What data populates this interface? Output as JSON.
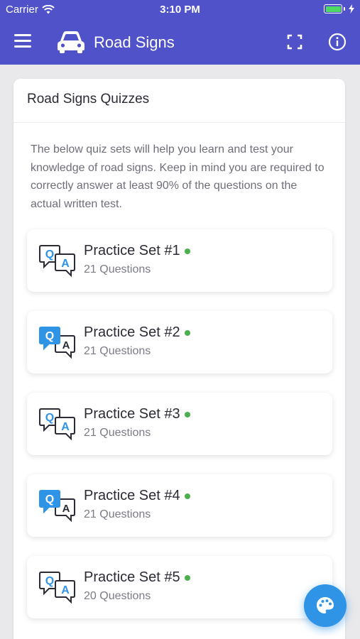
{
  "status": {
    "carrier": "Carrier",
    "time": "3:10 PM"
  },
  "appbar": {
    "title": "Road Signs"
  },
  "section": {
    "title": "Road Signs Quizzes",
    "description": "The below quiz sets will help you learn and test your knowledge of road signs. Keep in mind you are required to correctly answer at least 90% of the questions on the actual written test."
  },
  "quizzes": [
    {
      "name": "Practice Set #1",
      "count": "21 Questions",
      "icon": "qa-outline-icon"
    },
    {
      "name": "Practice Set #2",
      "count": "21 Questions",
      "icon": "qa-filled-icon"
    },
    {
      "name": "Practice Set #3",
      "count": "21 Questions",
      "icon": "qa-outline-icon"
    },
    {
      "name": "Practice Set #4",
      "count": "21 Questions",
      "icon": "qa-filled-icon"
    },
    {
      "name": "Practice Set #5",
      "count": "20 Questions",
      "icon": "qa-outline-icon"
    }
  ],
  "colors": {
    "primary": "#4f52c9",
    "accent": "#2f93e6",
    "status_dot": "#4caf50"
  }
}
